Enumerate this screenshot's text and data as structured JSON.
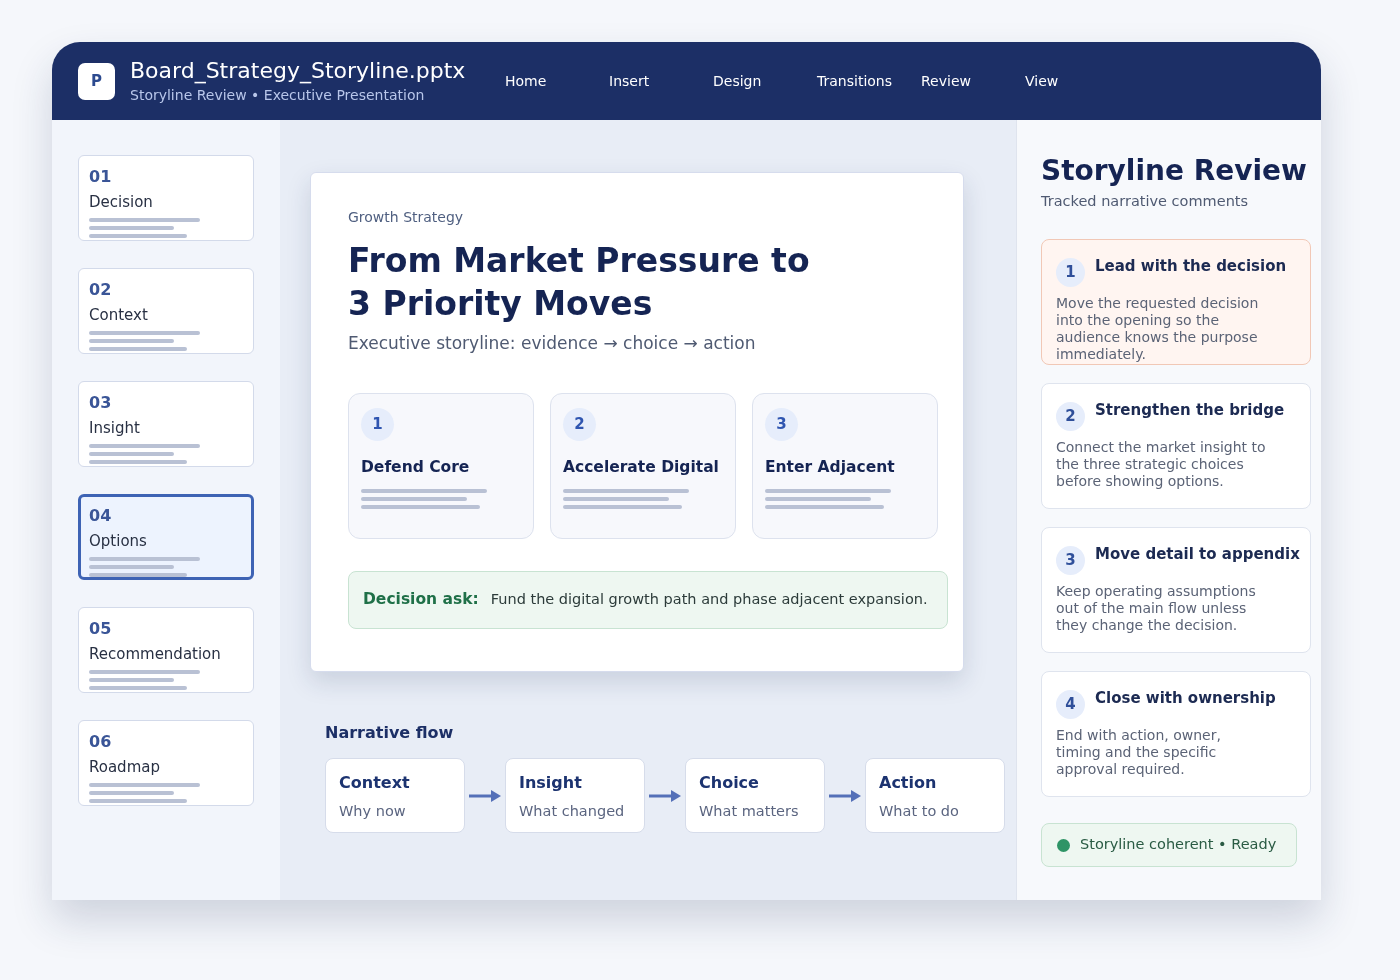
{
  "window": {
    "app_letter": "P",
    "title": "Board_Strategy_Storyline.pptx",
    "subtitle": "Storyline Review • Executive Presentation"
  },
  "menu": [
    "Home",
    "Insert",
    "Design",
    "Transitions",
    "Review",
    "View"
  ],
  "slides": [
    {
      "number": "01",
      "title": "Decision",
      "selected": false
    },
    {
      "number": "02",
      "title": "Context",
      "selected": false
    },
    {
      "number": "03",
      "title": "Insight",
      "selected": false
    },
    {
      "number": "04",
      "title": "Options",
      "selected": true
    },
    {
      "number": "05",
      "title": "Recommendation",
      "selected": false
    },
    {
      "number": "06",
      "title": "Roadmap",
      "selected": false
    }
  ],
  "slide": {
    "eyebrow": "Growth Strategy",
    "title_lines": [
      "From Market Pressure to",
      "3 Priority Moves"
    ],
    "subtitle": "Executive storyline: evidence → choice → action",
    "options": [
      {
        "number": "1",
        "title": "Defend Core"
      },
      {
        "number": "2",
        "title": "Accelerate Digital"
      },
      {
        "number": "3",
        "title": "Enter Adjacent"
      }
    ],
    "decision": {
      "label": "Decision ask:",
      "text": "Fund the digital growth path and phase adjacent expansion."
    }
  },
  "narrative_flow": {
    "title": "Narrative flow",
    "steps": [
      {
        "title": "Context",
        "caption": "Why now"
      },
      {
        "title": "Insight",
        "caption": "What changed"
      },
      {
        "title": "Choice",
        "caption": "What matters"
      },
      {
        "title": "Action",
        "caption": "What to do"
      }
    ]
  },
  "review": {
    "title": "Storyline Review",
    "subtitle": "Tracked narrative comments",
    "comments": [
      {
        "number": "1",
        "title": "Lead with the decision",
        "text": "Move the requested decision into the opening so the audience knows the purpose immediately.",
        "selected": true
      },
      {
        "number": "2",
        "title": "Strengthen the bridge",
        "text": "Connect the market insight to the three strategic choices before showing options.",
        "selected": false
      },
      {
        "number": "3",
        "title": "Move detail to appendix",
        "text": "Keep operating assumptions out of the main flow unless they change the decision.",
        "selected": false
      },
      {
        "number": "4",
        "title": "Close with ownership",
        "text": "End with action, owner, timing and the specific approval required.",
        "selected": false
      }
    ],
    "status": {
      "text": "Storyline coherent • Ready",
      "color": "#2e9466"
    }
  }
}
